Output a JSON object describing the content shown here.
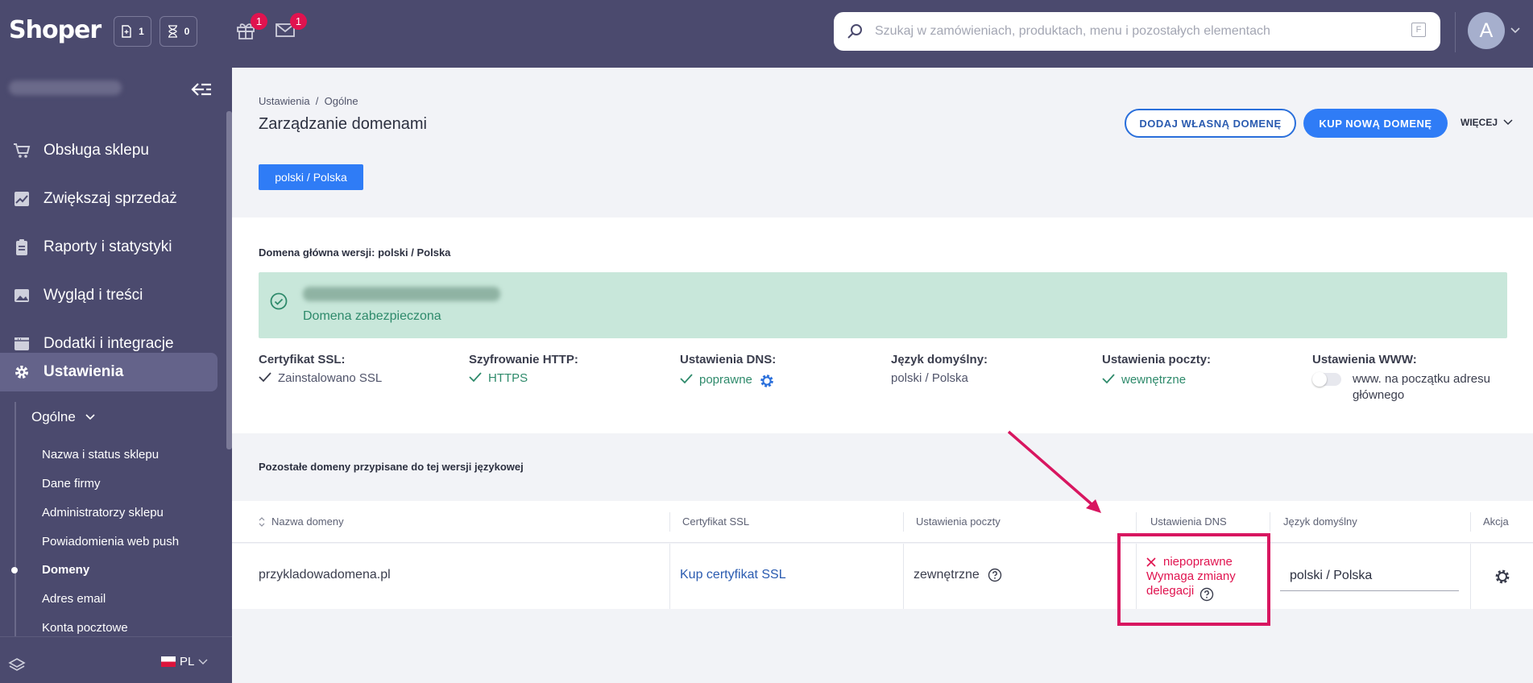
{
  "topbar": {
    "logo": "Shoper",
    "orders_count": "1",
    "pending_count": "0",
    "gifts_badge": "1",
    "messages_badge": "1",
    "search_placeholder": "Szukaj w zamówieniach, produktach, menu i pozostałych elementach",
    "search_shortcut": "F",
    "avatar_letter": "A"
  },
  "sidebar": {
    "items": [
      {
        "label": "Obsługa sklepu",
        "icon": "cart-icon"
      },
      {
        "label": "Zwiększaj sprzedaż",
        "icon": "chart-icon"
      },
      {
        "label": "Raporty i statystyki",
        "icon": "clipboard-icon"
      },
      {
        "label": "Wygląd i treści",
        "icon": "image-icon"
      },
      {
        "label": "Dodatki i integracje",
        "icon": "window-icon"
      },
      {
        "label": "Ustawienia",
        "icon": "gear-icon"
      }
    ],
    "sub_head": "Ogólne",
    "sub_items": [
      "Nazwa i status sklepu",
      "Dane firmy",
      "Administratorzy sklepu",
      "Powiadomienia web push",
      "Domeny",
      "Adres email",
      "Konta pocztowe"
    ],
    "active_sub": "Domeny",
    "language": "PL"
  },
  "main": {
    "breadcrumb": "Ustawienia  /  Ogólne",
    "title": "Zarządzanie domenami",
    "btn_add_own": "DODAJ WŁASNĄ DOMENĘ",
    "btn_buy_new": "KUP NOWĄ DOMENĘ",
    "more": "WIĘCEJ",
    "lang_tab": "polski / Polska",
    "main_domain_title": "Domena główna wersji: polski / Polska",
    "secured_status": "Domena zabezpieczona",
    "info": {
      "ssl_label": "Certyfikat SSL:",
      "ssl_value": "Zainstalowano SSL",
      "http_label": "Szyfrowanie HTTP:",
      "http_value": "HTTPS",
      "dns_label": "Ustawienia DNS:",
      "dns_value": "poprawne",
      "lang_label": "Język domyślny:",
      "lang_value": "polski / Polska",
      "mail_label": "Ustawienia poczty:",
      "mail_value": "wewnętrzne",
      "www_label": "Ustawienia WWW:",
      "www_value": "www. na początku adresu głównego"
    },
    "other_domains_title": "Pozostałe domeny przypisane do tej wersji językowej",
    "table": {
      "headers": [
        "Nazwa domeny",
        "Certyfikat SSL",
        "Ustawienia poczty",
        "Ustawienia DNS",
        "Język domyślny",
        "Akcja"
      ],
      "row": {
        "domain": "przykladowadomena.pl",
        "ssl": "Kup certyfikat SSL",
        "mail": "zewnętrzne",
        "dns_status": "niepoprawne",
        "dns_note": "Wymaga zmiany delegacji",
        "lang": "polski / Polska"
      }
    }
  },
  "colors": {
    "sidebar": "#4b4a6e",
    "primary": "#2f7cf6",
    "success": "#2e8a6b",
    "error": "#e0134f",
    "highlight": "#d81660"
  }
}
